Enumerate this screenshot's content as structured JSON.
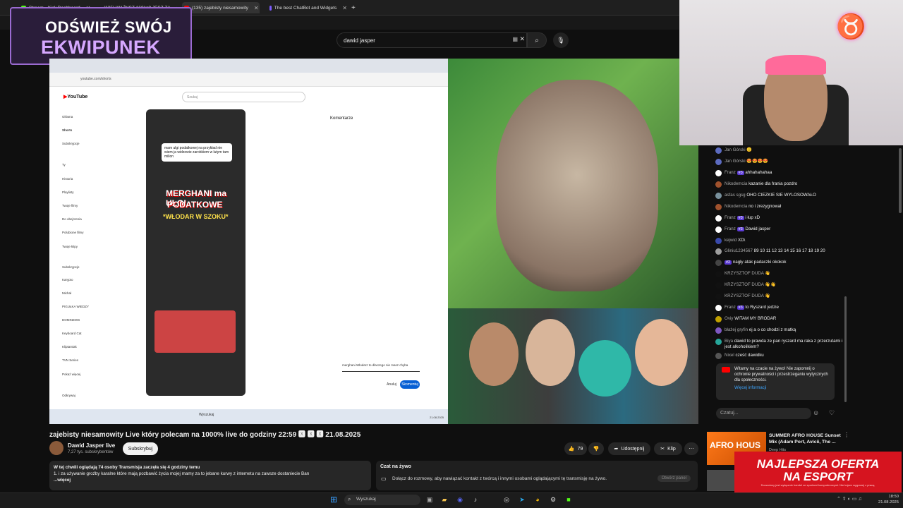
{
  "browser_tabs": [
    {
      "title": "Stream - Kick Dashboard",
      "color": "#53fc18"
    },
    {
      "title": "(135) WAŻYSZ 160kg? JESZ ZA",
      "color": "#ff0000"
    },
    {
      "title": "(135) zajebisty niesamowity",
      "color": "#ff0000"
    },
    {
      "title": "The best ChatBot and Widgets",
      "color": "#7c5cff"
    }
  ],
  "overlay_badge": {
    "line1": "ODŚWIEŻ SWÓJ",
    "line2": "EKWIPUNEK"
  },
  "search": {
    "value": "dawid jasper"
  },
  "inner_screen": {
    "search_placeholder": "Szukaj",
    "sidebar": [
      "Główna",
      "Shorts",
      "Subskrypcje",
      "Ty",
      "Historia",
      "Playlisty",
      "Twoje filmy",
      "Do obejrzenia",
      "Polubione filmy",
      "Twoje klipy",
      "Subskrypcje",
      "Karypto",
      "Michał",
      "PIGUŁKA WIEDZY",
      "DOMINEWS",
      "Keyboard Cat",
      "Kliptamiak",
      "TVN Series",
      "Pokaż więcej",
      "Odkrywaj"
    ],
    "short_bubble": "mam ulgi podatkowej na przykład nie wiem ja widzowie zarobkiem w lutym tam milion",
    "short_caption_1": "MERGHANI ma ULGI",
    "short_caption_2": "PODATKOWE",
    "short_caption_3": "*WŁODAR W SZOKU*",
    "comments_title": "Komentarze",
    "comment_box": "merghani Włodarz to dlaczego nie masz chyba",
    "cancel": "Anuluj",
    "submit": "Skomentuj",
    "taskbar_search": "Wyszukaj",
    "taskbar_clock": "21.08.2025"
  },
  "video": {
    "title": "zajebisty niesamowity Live który polecam na 1000% live do godziny 22:59 🆇 🆇 🆇 21.08.2025",
    "channel": "Dawid Jasper live",
    "subscribers": "7,27 tys. subskrybentów",
    "subscribe_label": "Subskrybuj",
    "likes": "79",
    "share_label": "Udostępnij",
    "clip_label": "Klip"
  },
  "description": {
    "stats": "W tej chwili oglądają 74 osoby  Transmisja zaczęła się 4 godziny temu",
    "line1": "1. i za używanie groźby karalne które mają pozbawić życia mojej mamy  za to jebane kurwy z internetu na zawsze dostaniecie Ban",
    "more": "...więcej"
  },
  "live_chat_panel": {
    "title": "Czat na żywo",
    "body": "Dołącz do rozmowy, aby nawiązać kontakt z twórcą i innymi osobami oglądającymi tę transmisję na żywo.",
    "button": "Otwórz panel"
  },
  "chat": [
    {
      "name": "Jan Górski",
      "text": "🙂",
      "badge": "",
      "color": "#5c6bc0"
    },
    {
      "name": "Jan Górski",
      "text": "😍😍😍😍",
      "badge": "",
      "color": "#5c6bc0"
    },
    {
      "name": "Franz",
      "text": "ahhahahahaa",
      "badge": "#3",
      "color": "#ffffff"
    },
    {
      "name": "Nikodemcia",
      "text": "kazanie dla frania pozdro",
      "badge": "",
      "color": "#a0522d"
    },
    {
      "name": "asfas sgsg",
      "text": "OHO CIEZKIE SIE WYLOSOWAŁO",
      "badge": "",
      "color": "#78909c"
    },
    {
      "name": "Nikodemcia",
      "text": "no i zrezygnował",
      "badge": "",
      "color": "#a0522d"
    },
    {
      "name": "Franz",
      "text": "i łup xD",
      "badge": "#3",
      "color": "#ffffff"
    },
    {
      "name": "Franz",
      "text": "Dawid jasper",
      "badge": "#3",
      "color": "#ffffff"
    },
    {
      "name": "kejwid",
      "text": "XD\\",
      "badge": "",
      "color": "#3949ab"
    },
    {
      "name": "Gliniu1234567",
      "text": "89 10 11 12 13 14 15 16 17 18 19 20",
      "badge": "",
      "color": "#9e9e9e"
    },
    {
      "name": "",
      "text": "nagły atak padaczki okokok",
      "badge": "#2",
      "color": "#444"
    },
    {
      "name": "KRZYSZTOF DUDA",
      "text": "👋",
      "badge": "",
      "color": "#111"
    },
    {
      "name": "KRZYSZTOF DUDA",
      "text": "👋👋",
      "badge": "",
      "color": "#111"
    },
    {
      "name": "KRZYSZTOF DUDA",
      "text": "👋",
      "badge": "",
      "color": "#111"
    },
    {
      "name": "Franz",
      "text": "to Ryszard jedzie",
      "badge": "#3",
      "color": "#ffffff"
    },
    {
      "name": "Oviy",
      "text": "WITAM MY BRODAR",
      "badge": "",
      "color": "#c0a000"
    },
    {
      "name": "błażej gryfin",
      "text": "ej a o co chodzi z matką",
      "badge": "",
      "color": "#7e57c2"
    },
    {
      "name": "Biya",
      "text": "dawid to prawda ze pan ryszard ma raka z przerzutami i jest alkoholikiem?",
      "badge": "",
      "color": "#26a69a"
    },
    {
      "name": "Nixel",
      "text": "cześć dawidku",
      "badge": "",
      "color": "#555"
    }
  ],
  "chat_notice": {
    "text": "Witamy na czacie na żywo! Nie zapomnij o ochronie prywatności i przestrzeganiu wytycznych dla społeczności.",
    "link": "Więcej informacji"
  },
  "chat_input_placeholder": "Czatuj...",
  "related": {
    "title": "SUMMER AFRO HOUSE Sunset Mix (Adam Port, Avicii, The ...",
    "channel": "Deep Hits",
    "thumb_text": "AFRO HOUS"
  },
  "promo": {
    "line1": "NAJLEPSZA OFERTA",
    "line2": "NA ESPORT",
    "fine_print": "Dozwolony jest wyłącznie handel ze sportami komputerowymi. Nie kojarz wygranej z pracą."
  },
  "win_taskbar": {
    "search": "Wyszukaj",
    "time": "18:50",
    "date": "21.08.2025"
  },
  "colors": {
    "yt_red": "#ff0000",
    "link_blue": "#3ea6ff",
    "member_badge": "#5c3bd6",
    "promo_red": "#d6141f"
  }
}
